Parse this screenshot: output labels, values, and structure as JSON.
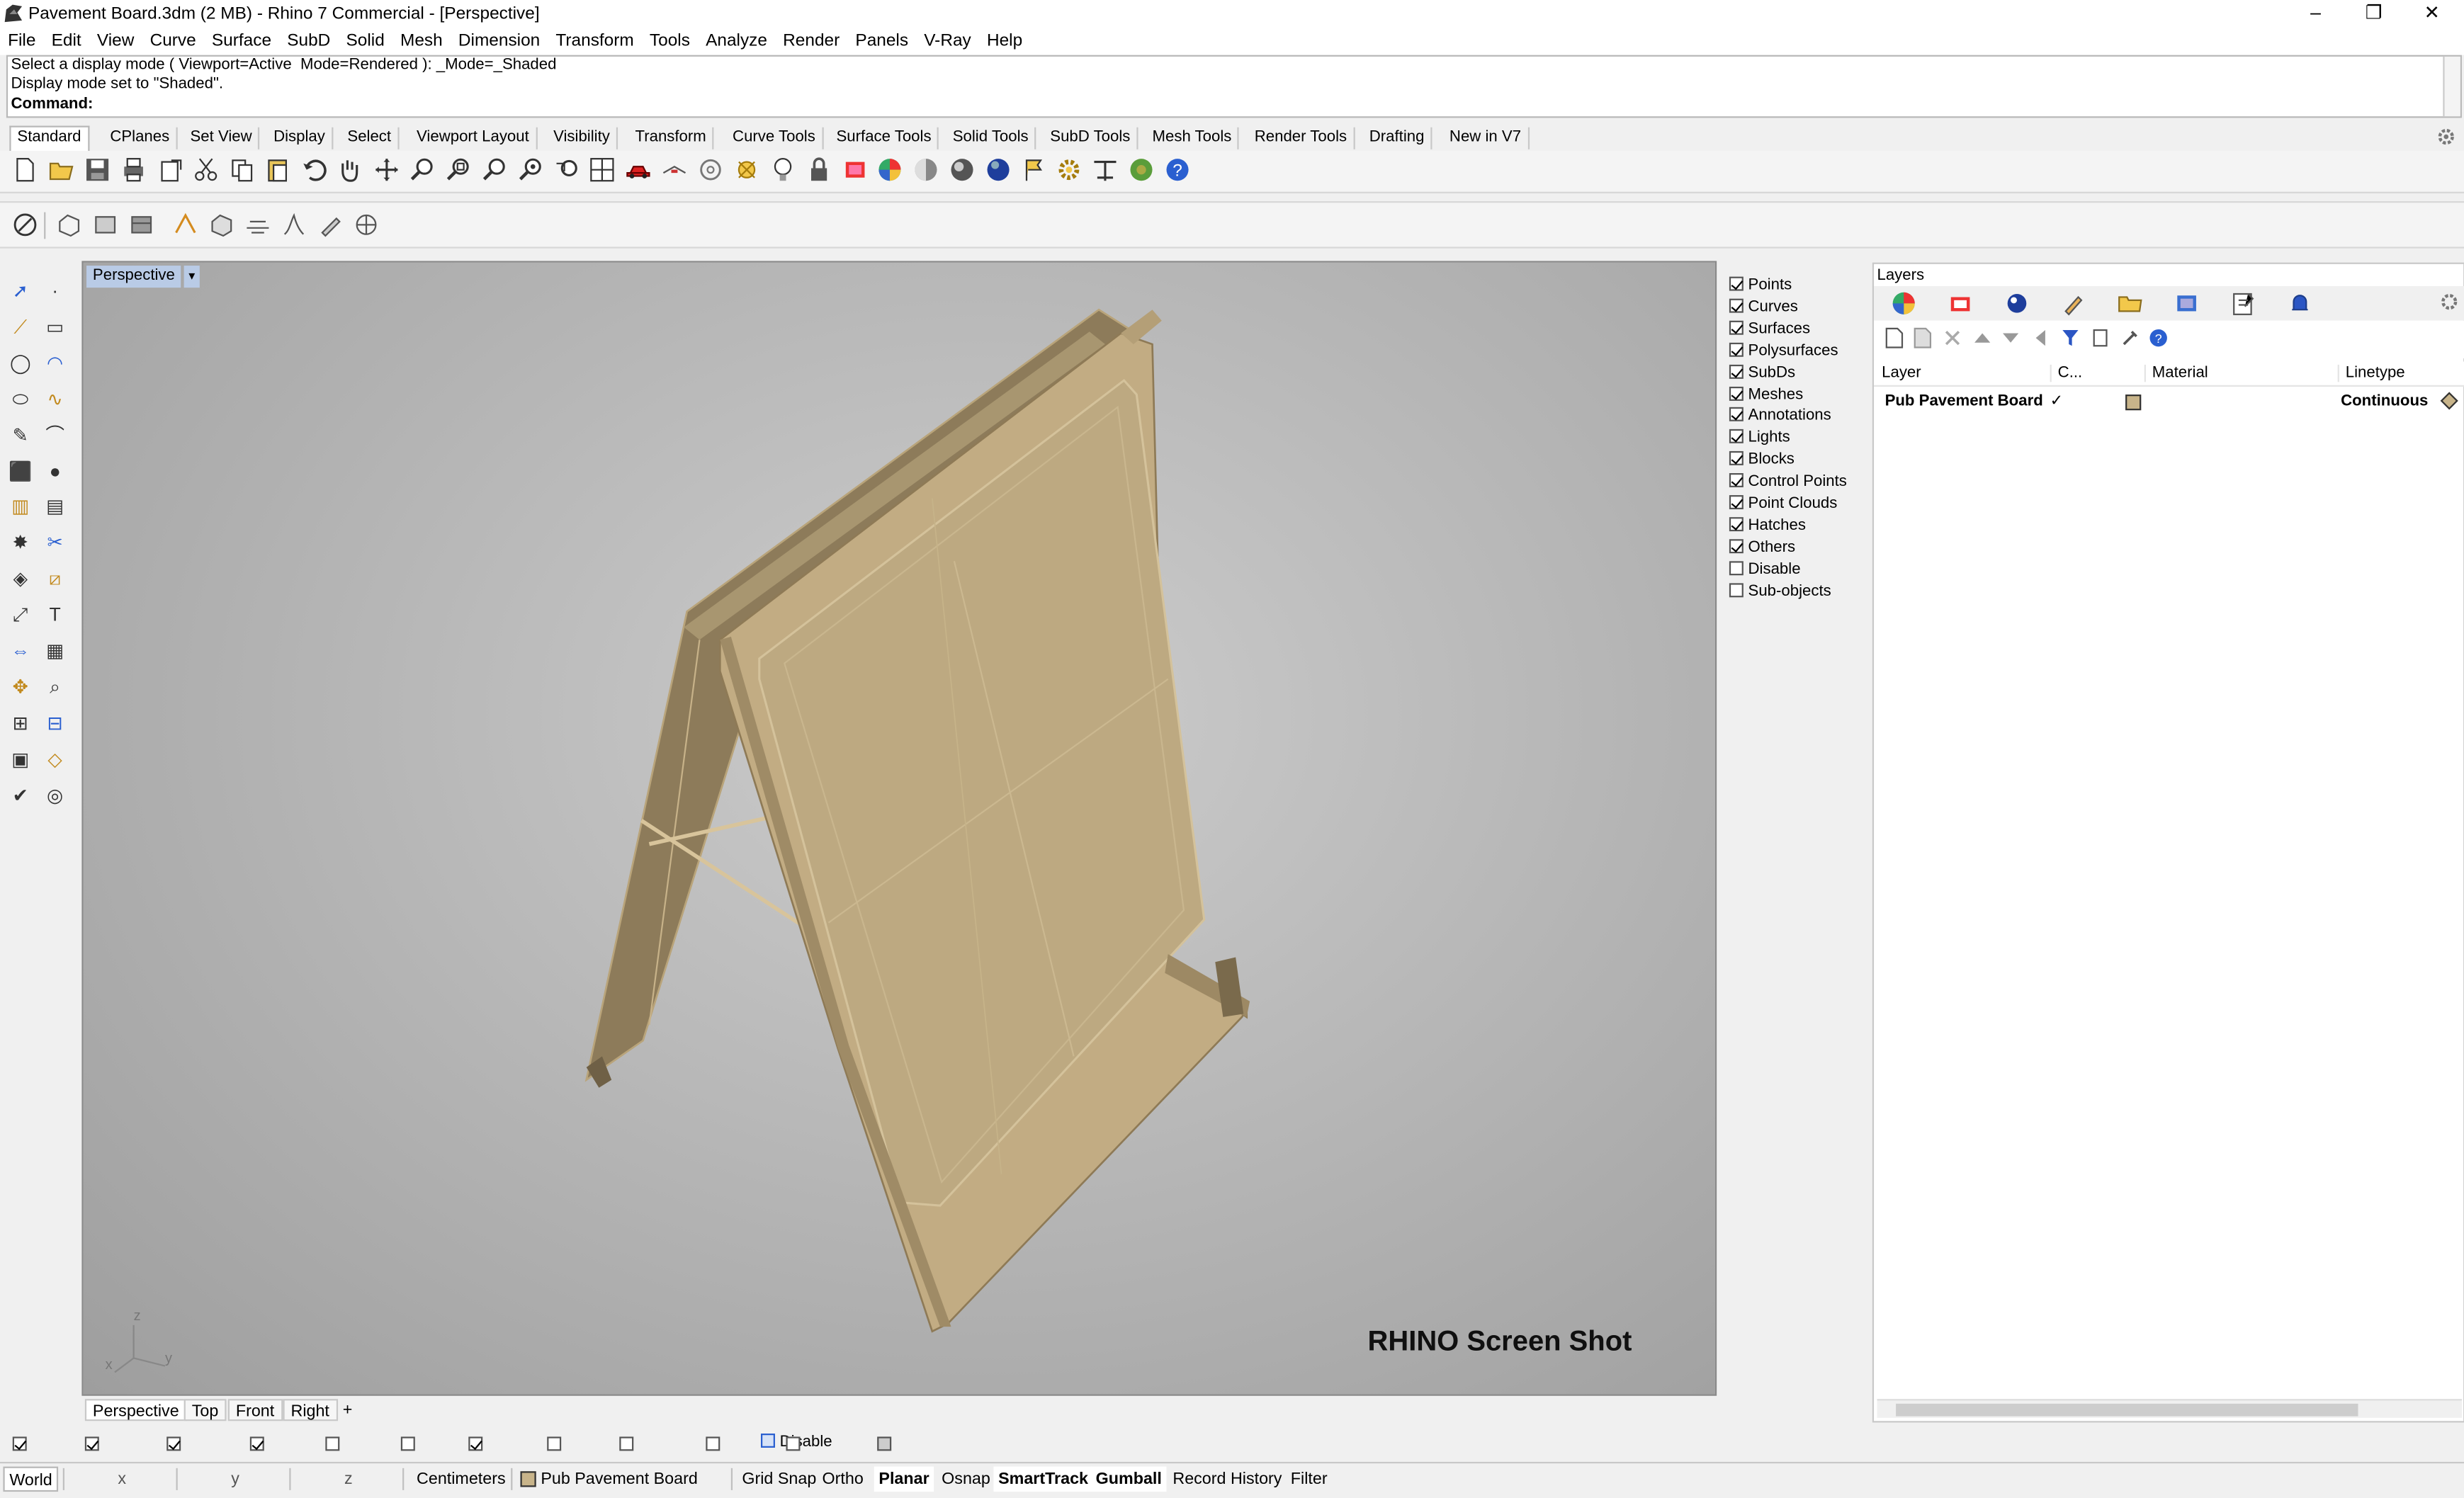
{
  "window": {
    "title": "Pavement Board.3dm (2 MB) - Rhino 7 Commercial - [Perspective]",
    "minimize": "–",
    "restore": "❐",
    "close": "✕"
  },
  "menu": [
    "File",
    "Edit",
    "View",
    "Curve",
    "Surface",
    "SubD",
    "Solid",
    "Mesh",
    "Dimension",
    "Transform",
    "Tools",
    "Analyze",
    "Render",
    "Panels",
    "V-Ray",
    "Help"
  ],
  "command": {
    "history1": "Select a display mode ( Viewport=Active  Mode=Rendered ): _Mode=_Shaded",
    "history2": "Display mode set to \"Shaded\".",
    "prompt": "Command:"
  },
  "toolbar_tabs": [
    "Standard",
    "CPlanes",
    "Set View",
    "Display",
    "Select",
    "Viewport Layout",
    "Visibility",
    "Transform",
    "Curve Tools",
    "Surface Tools",
    "Solid Tools",
    "SubD Tools",
    "Mesh Tools",
    "Render Tools",
    "Drafting",
    "New in V7"
  ],
  "viewport": {
    "title": "Perspective",
    "dropdown": "▾",
    "watermark": "RHINO Screen Shot",
    "axis": {
      "z": "z",
      "y": "y",
      "x": "x"
    }
  },
  "viewport_tabs": [
    "Perspective",
    "Top",
    "Front",
    "Right",
    "+"
  ],
  "object_filters": [
    {
      "label": "Points",
      "checked": true
    },
    {
      "label": "Curves",
      "checked": true
    },
    {
      "label": "Surfaces",
      "checked": true
    },
    {
      "label": "Polysurfaces",
      "checked": true
    },
    {
      "label": "SubDs",
      "checked": true
    },
    {
      "label": "Meshes",
      "checked": true
    },
    {
      "label": "Annotations",
      "checked": true
    },
    {
      "label": "Lights",
      "checked": true
    },
    {
      "label": "Blocks",
      "checked": true
    },
    {
      "label": "Control Points",
      "checked": true
    },
    {
      "label": "Point Clouds",
      "checked": true
    },
    {
      "label": "Hatches",
      "checked": true
    },
    {
      "label": "Others",
      "checked": true
    },
    {
      "label": "Disable",
      "checked": false
    },
    {
      "label": "Sub-objects",
      "checked": false
    }
  ],
  "layers": {
    "header": "Layers",
    "columns": {
      "layer": "Layer",
      "current": "C...",
      "material": "Material",
      "linetype": "Linetype"
    },
    "row": {
      "name": "Pub Pavement Board",
      "current": "✓",
      "linetype": "Continuous",
      "color": "#c8b48a"
    }
  },
  "osnap": {
    "disable_label": "Disable"
  },
  "status": {
    "world": "World",
    "x": "x",
    "y": "y",
    "z": "z",
    "units": "Centimeters",
    "layer": "Pub Pavement Board",
    "grid_snap": "Grid Snap",
    "ortho": "Ortho",
    "planar": "Planar",
    "osnap": "Osnap",
    "smarttrack": "SmartTrack",
    "gumball": "Gumball",
    "record_history": "Record History",
    "filter": "Filter"
  },
  "colors": {
    "board": "#c9b48a",
    "board_dark": "#8a7856",
    "viewport_tab": "#b9cbe6",
    "accent": "#1e62c8"
  }
}
